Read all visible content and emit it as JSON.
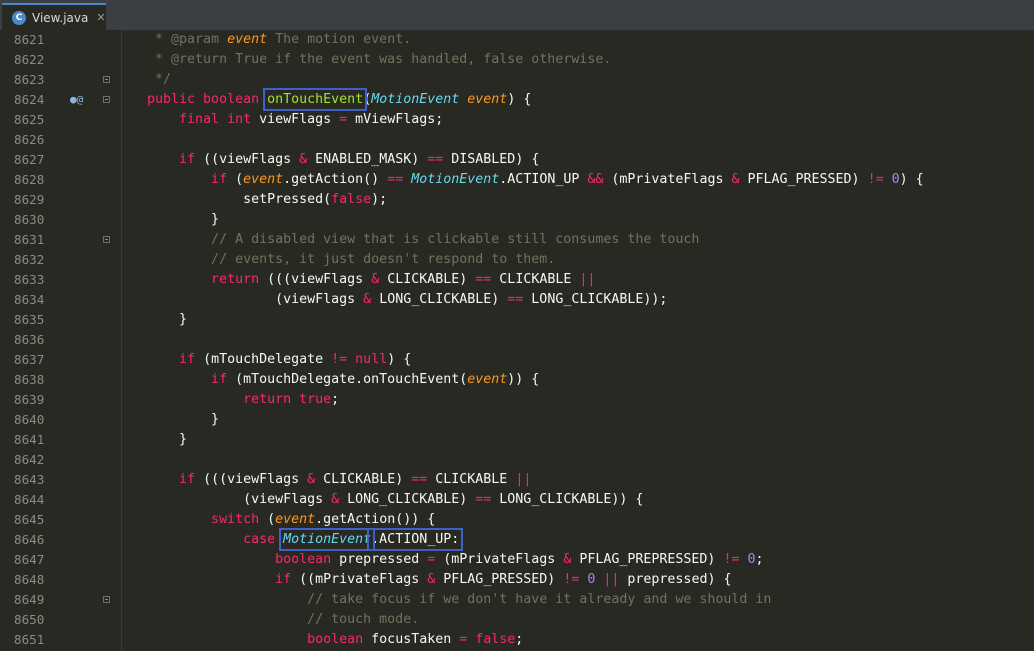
{
  "tab": {
    "icon_letter": "C",
    "label": "View.java",
    "close": "✕"
  },
  "editor": {
    "lines": [
      {
        "n": "8621",
        "segs": [
          [
            "cm",
            "    * @param "
          ],
          [
            "pm",
            "event"
          ],
          [
            "cm",
            " The motion event."
          ]
        ]
      },
      {
        "n": "8622",
        "segs": [
          [
            "cm",
            "    * @return True if the event was handled, false otherwise."
          ]
        ]
      },
      {
        "n": "8623",
        "fold": true,
        "segs": [
          [
            "cm",
            "    */"
          ]
        ]
      },
      {
        "n": "8624",
        "fold": true,
        "ann": "●@",
        "segs": [
          [
            "kw",
            "   public boolean "
          ],
          [
            "fn box",
            "onTouchEvent"
          ],
          [
            "",
            "("
          ],
          [
            "ty",
            "MotionEvent"
          ],
          [
            "pm",
            " event"
          ],
          [
            "",
            ") {"
          ]
        ]
      },
      {
        "n": "8625",
        "segs": [
          [
            "kw",
            "       final int "
          ],
          [
            "",
            "viewFlags "
          ],
          [
            "kw",
            "="
          ],
          [
            "",
            " mViewFlags;"
          ]
        ]
      },
      {
        "n": "8626",
        "segs": []
      },
      {
        "n": "8627",
        "segs": [
          [
            "kw",
            "       if "
          ],
          [
            "",
            "((viewFlags "
          ],
          [
            "kw",
            "&"
          ],
          [
            "",
            " ENABLED_MASK) "
          ],
          [
            "kw",
            "=="
          ],
          [
            "",
            " DISABLED) {"
          ]
        ]
      },
      {
        "n": "8628",
        "segs": [
          [
            "kw",
            "           if "
          ],
          [
            "",
            "("
          ],
          [
            "pm",
            "event"
          ],
          [
            "",
            ".getAction() "
          ],
          [
            "kw",
            "=="
          ],
          [
            "ty",
            " MotionEvent"
          ],
          [
            "",
            ".ACTION_UP "
          ],
          [
            "kw",
            "&&"
          ],
          [
            "",
            " (mPrivateFlags "
          ],
          [
            "kw",
            "&"
          ],
          [
            "",
            " PFLAG_PRESSED) "
          ],
          [
            "kw",
            "!="
          ],
          [
            "num",
            " 0"
          ],
          [
            "",
            ") {"
          ]
        ]
      },
      {
        "n": "8629",
        "segs": [
          [
            "",
            "               setPressed("
          ],
          [
            "kw",
            "false"
          ],
          [
            "",
            ");"
          ]
        ]
      },
      {
        "n": "8630",
        "segs": [
          [
            "",
            "           }"
          ]
        ]
      },
      {
        "n": "8631",
        "fold": true,
        "segs": [
          [
            "cm",
            "           // A disabled view that is clickable still consumes the touch"
          ]
        ]
      },
      {
        "n": "8632",
        "segs": [
          [
            "cm",
            "           // events, it just doesn't respond to them."
          ]
        ]
      },
      {
        "n": "8633",
        "segs": [
          [
            "kw",
            "           return "
          ],
          [
            "",
            "(((viewFlags "
          ],
          [
            "kw",
            "&"
          ],
          [
            "",
            " CLICKABLE) "
          ],
          [
            "kw",
            "=="
          ],
          [
            "",
            " CLICKABLE "
          ],
          [
            "kw",
            "||"
          ]
        ]
      },
      {
        "n": "8634",
        "segs": [
          [
            "",
            "                   (viewFlags "
          ],
          [
            "kw",
            "&"
          ],
          [
            "",
            " LONG_CLICKABLE) "
          ],
          [
            "kw",
            "=="
          ],
          [
            "",
            " LONG_CLICKABLE));"
          ]
        ]
      },
      {
        "n": "8635",
        "segs": [
          [
            "",
            "       }"
          ]
        ]
      },
      {
        "n": "8636",
        "segs": []
      },
      {
        "n": "8637",
        "segs": [
          [
            "kw",
            "       if "
          ],
          [
            "",
            "(mTouchDelegate "
          ],
          [
            "kw",
            "!="
          ],
          [
            "kw",
            " null"
          ],
          [
            "",
            ") {"
          ]
        ]
      },
      {
        "n": "8638",
        "segs": [
          [
            "kw",
            "           if "
          ],
          [
            "",
            "(mTouchDelegate.onTouchEvent("
          ],
          [
            "pm",
            "event"
          ],
          [
            "",
            ")) {"
          ]
        ]
      },
      {
        "n": "8639",
        "segs": [
          [
            "kw",
            "               return true"
          ],
          [
            "",
            ";"
          ]
        ]
      },
      {
        "n": "8640",
        "segs": [
          [
            "",
            "           }"
          ]
        ]
      },
      {
        "n": "8641",
        "segs": [
          [
            "",
            "       }"
          ]
        ]
      },
      {
        "n": "8642",
        "segs": []
      },
      {
        "n": "8643",
        "segs": [
          [
            "kw",
            "       if "
          ],
          [
            "",
            "(((viewFlags "
          ],
          [
            "kw",
            "&"
          ],
          [
            "",
            " CLICKABLE) "
          ],
          [
            "kw",
            "=="
          ],
          [
            "",
            " CLICKABLE "
          ],
          [
            "kw",
            "||"
          ]
        ]
      },
      {
        "n": "8644",
        "segs": [
          [
            "",
            "               (viewFlags "
          ],
          [
            "kw",
            "&"
          ],
          [
            "",
            " LONG_CLICKABLE) "
          ],
          [
            "kw",
            "=="
          ],
          [
            "",
            " LONG_CLICKABLE)) {"
          ]
        ]
      },
      {
        "n": "8645",
        "segs": [
          [
            "kw",
            "           switch "
          ],
          [
            "",
            "("
          ],
          [
            "pm",
            "event"
          ],
          [
            "",
            ".getAction()) {"
          ]
        ]
      },
      {
        "n": "8646",
        "segs": [
          [
            "kw",
            "               case "
          ],
          [
            "ty box",
            "MotionEvent"
          ],
          [
            "box",
            ".ACTION_UP:"
          ]
        ]
      },
      {
        "n": "8647",
        "segs": [
          [
            "kw",
            "                   boolean "
          ],
          [
            "",
            "prepressed "
          ],
          [
            "kw",
            "="
          ],
          [
            "",
            " (mPrivateFlags "
          ],
          [
            "kw",
            "&"
          ],
          [
            "",
            " PFLAG_PREPRESSED) "
          ],
          [
            "kw",
            "!="
          ],
          [
            "num",
            " 0"
          ],
          [
            "",
            ";"
          ]
        ]
      },
      {
        "n": "8648",
        "segs": [
          [
            "kw",
            "                   if "
          ],
          [
            "",
            "((mPrivateFlags "
          ],
          [
            "kw",
            "&"
          ],
          [
            "",
            " PFLAG_PRESSED) "
          ],
          [
            "kw",
            "!="
          ],
          [
            "num",
            " 0 "
          ],
          [
            "kw",
            "||"
          ],
          [
            "",
            " prepressed) {"
          ]
        ]
      },
      {
        "n": "8649",
        "fold": true,
        "segs": [
          [
            "cm",
            "                       // take focus if we don't have it already and we should in"
          ]
        ]
      },
      {
        "n": "8650",
        "segs": [
          [
            "cm",
            "                       // touch mode."
          ]
        ]
      },
      {
        "n": "8651",
        "segs": [
          [
            "kw",
            "                       boolean "
          ],
          [
            "",
            "focusTaken "
          ],
          [
            "kw",
            "="
          ],
          [
            "kw",
            " false"
          ],
          [
            "",
            ";"
          ]
        ]
      }
    ]
  }
}
